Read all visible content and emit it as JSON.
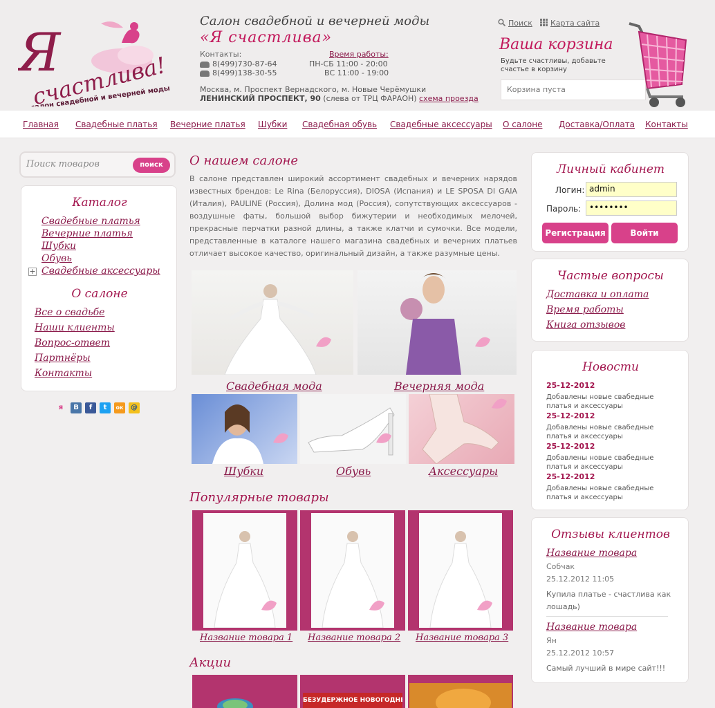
{
  "header": {
    "logo_alt": "Я счастлива! салон свадебной и вечерней моды",
    "salon_title": "Салон свадебной и вечерней моды",
    "salon_name": "«Я счастлива»",
    "contacts_label": "Контакты:",
    "phones": [
      "8(499)730-87-64",
      "8(499)138-30-55"
    ],
    "hours_label": "Время работы:",
    "hours": [
      "ПН-СБ 11:00 - 20:00",
      "ВС 11:00 - 19:00"
    ],
    "address_line1": "Москва, м. Проспект Вернадского, м. Новые Черёмушки",
    "address_bold": "ЛЕНИНСКИЙ ПРОСПЕКТ, 90",
    "address_rest": " (слева от ТРЦ ФАРАОН) ",
    "directions_link": "схема проезда",
    "search_link": "Поиск",
    "sitemap_link": "Карта сайта",
    "cart_title": "Ваша корзина",
    "cart_subtitle": "Будьте счастливы, добавьте счастье в корзину",
    "cart_status": "Корзина пуста"
  },
  "nav": [
    "Главная",
    "Свадебные платья",
    "Вечерние платья",
    "Шубки",
    "Свадебная обувь",
    "Свадебные аксессуары",
    "О салоне",
    "Доставка/Оплата",
    "Контакты"
  ],
  "search": {
    "placeholder": "Поиск товаров",
    "button": "поиск"
  },
  "catalog": {
    "title": "Каталог",
    "items": [
      "Свадебные платья",
      "Вечерние платья",
      "Шубки",
      "Обувь",
      "Свадебные аксессуары"
    ],
    "about_title": "О салоне",
    "about_items": [
      "Все о свадьбе",
      "Наши клиенты",
      "Вопрос-ответ",
      "Партнёры",
      "Контакты"
    ]
  },
  "social": [
    "я",
    "В",
    "f",
    "t",
    "ок",
    "@"
  ],
  "about": {
    "title": "О нашем салоне",
    "text": "В салоне представлен широкий ассортимент свадебных и вечерних нарядов известных брендов: Le Rina (Белоруссия), DIOSA (Испания) и LE SPOSA DI GAIA (Италия), PAULINE (Россия), Долина мод (Россия), сопутствующих аксессуаров - воздушные фаты, большой выбор бижутерии и необходимых мелочей, прекрасные перчатки разной длины, а также клатчи и сумочки. Все модели, представленные в каталоге нашего магазина свадебных и вечерних платьев отличает высокое качество, оригинальный дизайн, а также разумные цены."
  },
  "categories": {
    "wedding": "Свадебная мода",
    "evening": "Вечерняя мода",
    "furs": "Шубки",
    "shoes": "Обувь",
    "accessories": "Аксессуары"
  },
  "popular": {
    "title": "Популярные товары",
    "items": [
      "Название товара 1",
      "Название товара 2",
      "Название товара 3"
    ]
  },
  "promos": {
    "title": "Акции",
    "banner_text": "БЕЗУДЕРЖНОЕ НОВОГОДНЕЕ"
  },
  "login": {
    "title": "Личный кабинет",
    "login_label": "Логин:",
    "login_value": "admin",
    "password_label": "Пароль:",
    "password_value": "••••••••",
    "register": "Регистрация",
    "submit": "Войти"
  },
  "faq": {
    "title": "Частые вопросы",
    "items": [
      "Доставка и оплата",
      "Время работы",
      "Книга отзывов"
    ]
  },
  "news": {
    "title": "Новости",
    "items": [
      {
        "date": "25-12-2012",
        "text": "Добавлены новые свабедные платья и аксессуары"
      },
      {
        "date": "25-12-2012",
        "text": "Добавлены новые свабедные платья и аксессуары"
      },
      {
        "date": "25-12-2012",
        "text": "Добавлены новые свабедные платья и аксессуары"
      },
      {
        "date": "25-12-2012",
        "text": "Добавлены новые свабедные платья и аксессуары"
      }
    ]
  },
  "reviews": {
    "title": "Отзывы клиентов",
    "items": [
      {
        "product": "Название товара",
        "author": "Собчак",
        "date": "25.12.2012 11:05",
        "text": "Купила платье - счастлива как лошадь)"
      },
      {
        "product": "Название товара",
        "author": "Ян",
        "date": "25.12.2012 10:57",
        "text": "Самый лучший в мире сайт!!!"
      }
    ]
  },
  "colors": {
    "accent": "#c2185b",
    "link": "#8a1a4a",
    "button": "#d8418a",
    "product_frame": "#b3346e",
    "background": "#f1efef"
  }
}
